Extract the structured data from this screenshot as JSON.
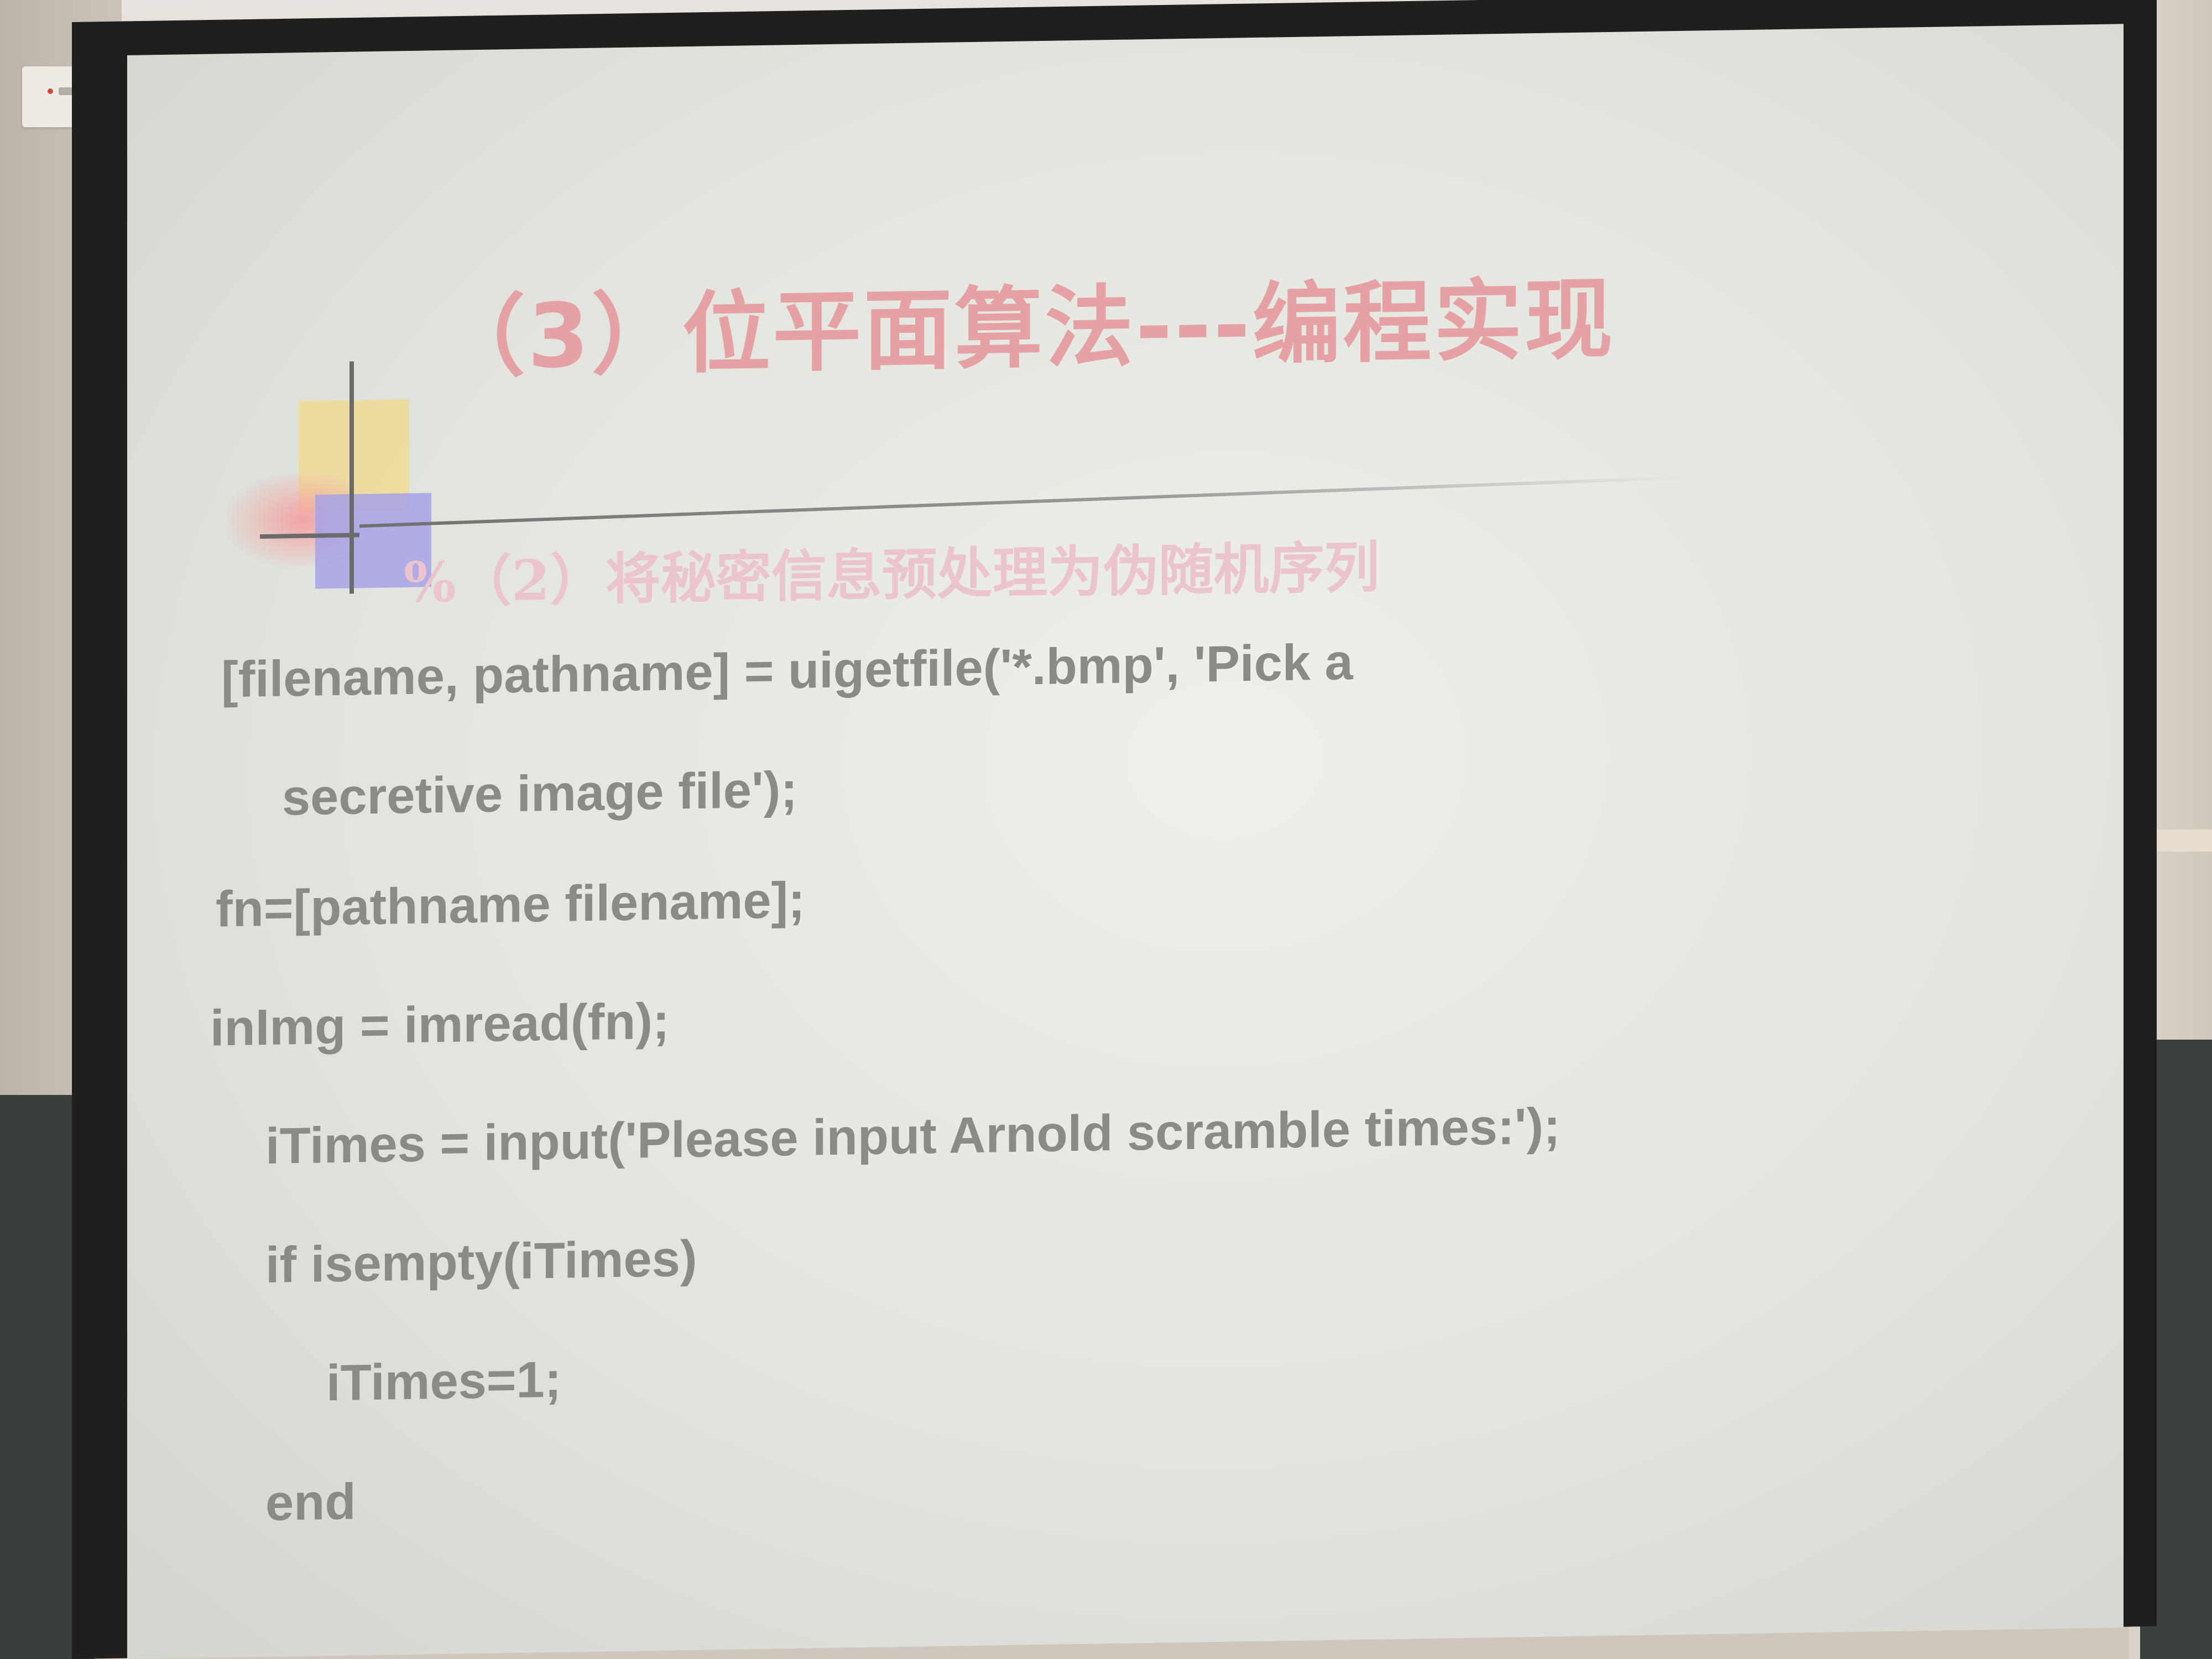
{
  "slide": {
    "title": "（3）位平面算法---编程实现",
    "comment": "%（2）将秘密信息预处理为伪随机序列",
    "code_lines": [
      "[filename, pathname] = uigetfile('*.bmp', 'Pick a",
      "secretive image file');",
      "fn=[pathname filename];",
      "inImg = imread(fn);",
      "iTimes = input('Please input Arnold scramble times:');",
      "if isempty(iTimes)",
      "iTimes=1;",
      "end"
    ]
  },
  "colors": {
    "title": "#e6a1a4",
    "comment": "#ecc4cd",
    "code": "#8a8a86",
    "slide_background": "#e2e4de",
    "frame": "#1e1f1e"
  }
}
